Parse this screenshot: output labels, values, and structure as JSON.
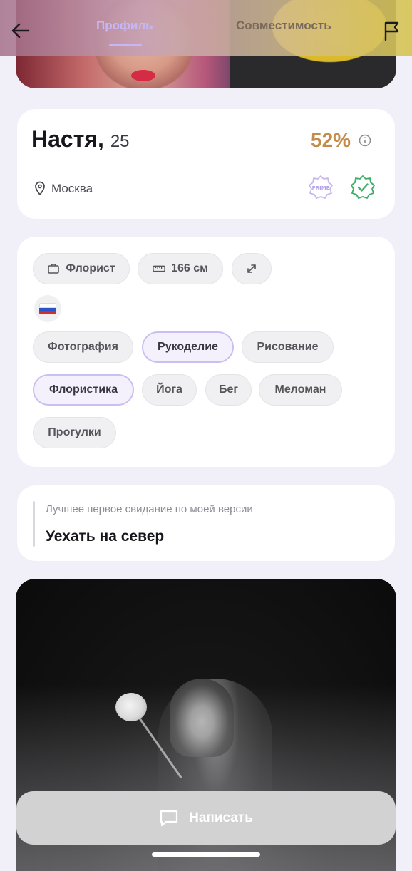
{
  "header": {
    "tabs": [
      {
        "label": "Профиль",
        "active": true
      },
      {
        "label": "Совместимость",
        "active": false
      }
    ],
    "icons": {
      "back": "arrow-left-icon",
      "report": "flag-icon"
    }
  },
  "profile": {
    "name": "Настя,",
    "age": "25",
    "compatibility": "52%",
    "city": "Москва",
    "badges": [
      "PRIME",
      "verified"
    ],
    "accent_color": "#c28d4a"
  },
  "details": {
    "occupation": "Флорист",
    "height": "166 см",
    "nationality_flag": "ru"
  },
  "interests": [
    {
      "label": "Фотография",
      "selected": false
    },
    {
      "label": "Рукоделие",
      "selected": true
    },
    {
      "label": "Рисование",
      "selected": false
    },
    {
      "label": "Флористика",
      "selected": true
    },
    {
      "label": "Йога",
      "selected": false
    },
    {
      "label": "Бег",
      "selected": false
    },
    {
      "label": "Меломан",
      "selected": false
    },
    {
      "label": "Прогулки",
      "selected": false
    }
  ],
  "first_date": {
    "label": "Лучшее первое свидание по моей версии",
    "value": "Уехать на север"
  },
  "actions": {
    "write_label": "Написать"
  }
}
